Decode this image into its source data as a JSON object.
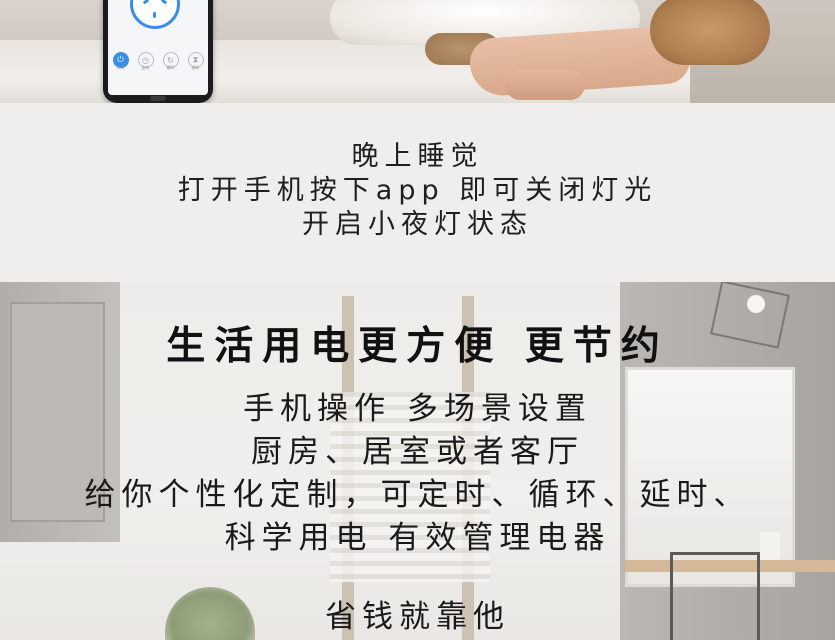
{
  "app_screen": {
    "nav_labels": [
      "开关",
      "定时",
      "循环",
      "延时"
    ]
  },
  "middle": {
    "lines": [
      "晚上睡觉",
      "打开手机按下app 即可关闭灯光",
      "开启小夜灯状态"
    ]
  },
  "bottom": {
    "headline": "生活用电更方便 更节约",
    "lines": [
      "手机操作 多场景设置",
      "厨房、居室或者客厅",
      "给你个性化定制，可定时、循环、延时、",
      "科学用电 有效管理电器"
    ],
    "slogan": "省钱就靠他"
  },
  "colors": {
    "accent": "#3b8ee8",
    "panel_bg": "#efeeec",
    "text": "#1a1a1a"
  },
  "icons": [
    "power-icon",
    "timer-icon",
    "loop-icon",
    "delay-icon",
    "socket-icon"
  ]
}
